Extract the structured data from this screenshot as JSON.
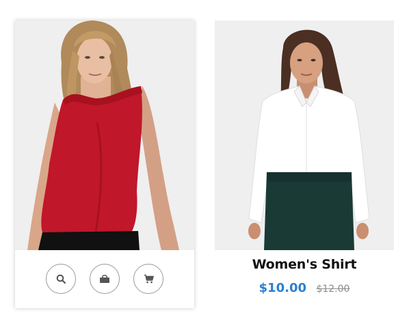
{
  "colors": {
    "accent": "#2b7fd0",
    "top_red": "#c0172a",
    "skirt_green": "#1a3a36",
    "photo_bg": "#efefef"
  },
  "products": [
    {
      "image": "woman-in-red-sleeveless-top",
      "actions": [
        {
          "icon": "search-icon"
        },
        {
          "icon": "shopping-bag-icon"
        },
        {
          "icon": "cart-icon"
        }
      ]
    },
    {
      "image": "woman-in-white-shirt",
      "name": "Women's Shirt",
      "price": "$10.00",
      "old_price": "$12.00"
    }
  ]
}
